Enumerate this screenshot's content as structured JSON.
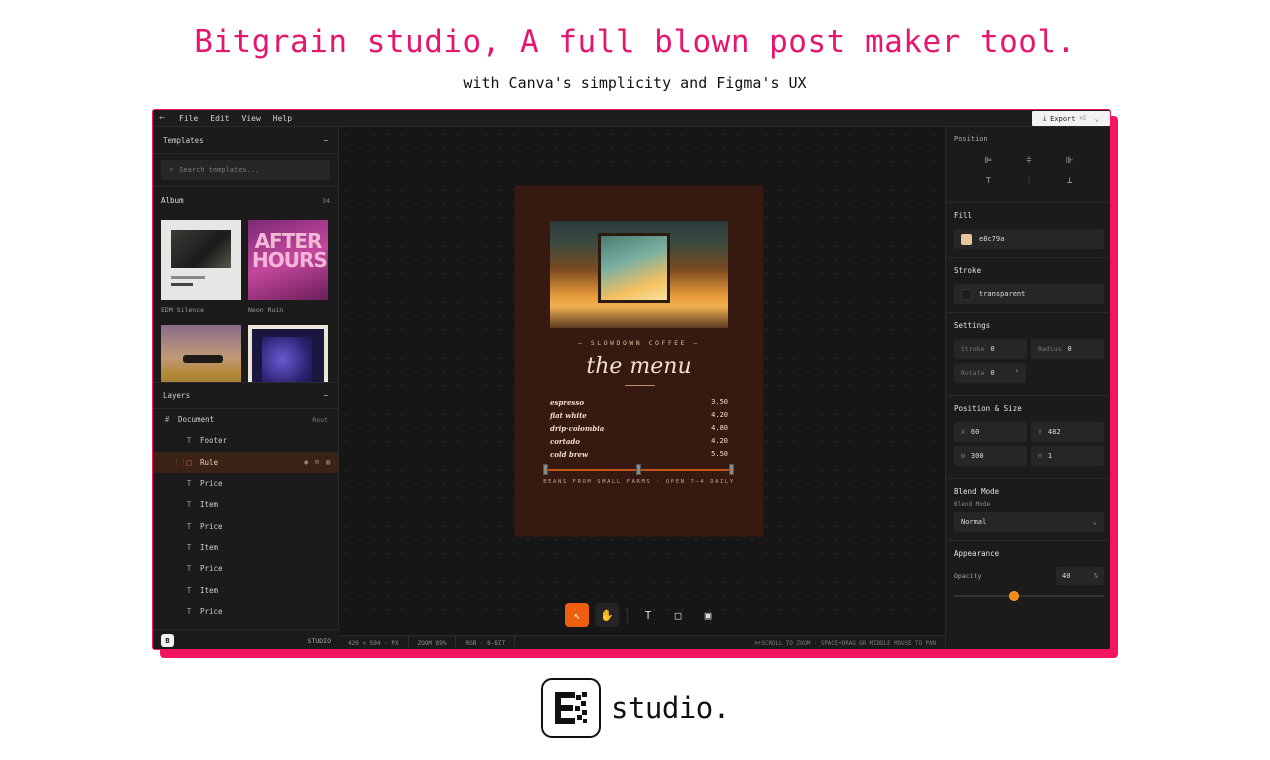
{
  "headline": "Bitgrain studio, A full blown post maker tool.",
  "subheadline": "with Canva's simplicity and Figma's UX",
  "menubar": {
    "back_icon": "←",
    "items": [
      "File",
      "Edit",
      "View",
      "Help"
    ],
    "export_label": "Export",
    "export_shortcut": "⌘E",
    "export_chevron": "⌄"
  },
  "templates": {
    "title": "Templates",
    "collapse": "−",
    "search_placeholder": "Search templates...",
    "album_title": "Album",
    "album_count": "34",
    "items": [
      {
        "label": "EDM Silence"
      },
      {
        "label": "Neon Ruin",
        "overlay": "AFTER HOURS"
      },
      {
        "label": ""
      },
      {
        "label": ""
      }
    ]
  },
  "layers": {
    "title": "Layers",
    "collapse": "−",
    "root": {
      "label": "Document",
      "tag": "Root"
    },
    "items": [
      {
        "label": "Footer",
        "icon": "T",
        "selected": false
      },
      {
        "label": "Rule",
        "icon": "□",
        "selected": true
      },
      {
        "label": "Price",
        "icon": "T",
        "selected": false
      },
      {
        "label": "Item",
        "icon": "T",
        "selected": false
      },
      {
        "label": "Price",
        "icon": "T",
        "selected": false
      },
      {
        "label": "Item",
        "icon": "T",
        "selected": false
      },
      {
        "label": "Price",
        "icon": "T",
        "selected": false
      },
      {
        "label": "Item",
        "icon": "T",
        "selected": false
      },
      {
        "label": "Price",
        "icon": "T",
        "selected": false
      }
    ]
  },
  "left_footer": {
    "brand": "STUDIO"
  },
  "poster": {
    "brandline": "— SLOWDOWN COFFEE —",
    "title": "the menu",
    "menu": [
      {
        "name": "espresso",
        "price": "3.50"
      },
      {
        "name": "flat white",
        "price": "4.20"
      },
      {
        "name": "drip·colombia",
        "price": "4.80"
      },
      {
        "name": "cortado",
        "price": "4.20"
      },
      {
        "name": "cold brew",
        "price": "5.50"
      }
    ],
    "footer": "BEANS FROM SMALL FARMS · OPEN 7–4 DAILY"
  },
  "toolbar": [
    "select-tool",
    "hand-tool",
    "text-tool",
    "rectangle-tool",
    "image-tool"
  ],
  "statusbar": {
    "size": "420 × 594 · PX",
    "zoom": "ZOOM 89%",
    "color_mode": "RGB · 8-BIT",
    "hint": "⌘+SCROLL TO ZOOM · SPACE+DRAG OR MIDDLE MOUSE TO PAN"
  },
  "inspector": {
    "position_title": "Position",
    "fill_title": "Fill",
    "fill_value": "e8c79a",
    "fill_color": "#e8c79a",
    "stroke_title": "Stroke",
    "stroke_value": "transparent",
    "settings_title": "Settings",
    "stroke_label": "Stroke",
    "stroke_width": "0",
    "radius_label": "Radius",
    "radius_value": "0",
    "rotate_label": "Rotate",
    "rotate_value": "0",
    "rotate_unit": "°",
    "pos_size_title": "Position & Size",
    "x_label": "X",
    "x_value": "60",
    "y_label": "Y",
    "y_value": "482",
    "w_label": "W",
    "w_value": "300",
    "h_label": "H",
    "h_value": "1",
    "blend_title": "Blend Mode",
    "blend_label": "Blend Mode",
    "blend_value": "Normal",
    "appearance_title": "Appearance",
    "opacity_label": "Opacity",
    "opacity_value": "40",
    "opacity_unit": "%",
    "opacity_fraction": 0.4
  },
  "bottom_logo": {
    "text": "studio."
  },
  "colors": {
    "accent": "#f5145f",
    "headline": "#e4166d",
    "tool_active": "#ef5f10",
    "poster_bg": "#361a12"
  }
}
